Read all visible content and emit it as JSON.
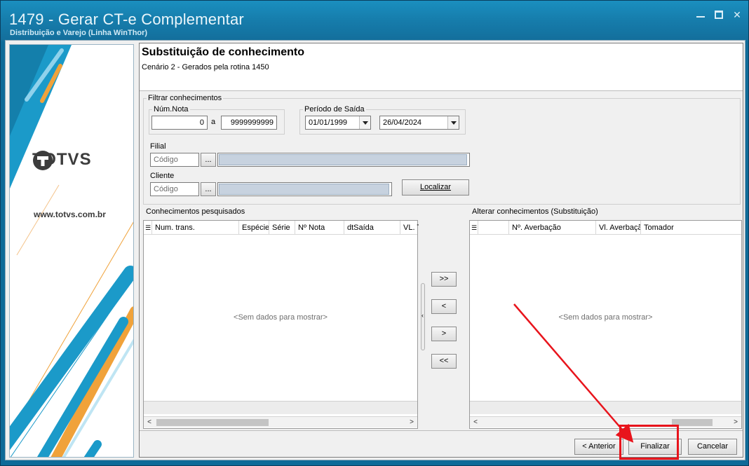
{
  "window": {
    "title": "1479 - Gerar CT-e Complementar",
    "subtitle": "Distribuição e Varejo (Linha WinThor)"
  },
  "brand": {
    "logo_text": "TOTVS",
    "site": "www.totvs.com.br"
  },
  "header": {
    "title": "Substituição de conhecimento",
    "subtitle": "Cenário 2 - Gerados pela rotina 1450"
  },
  "filter": {
    "group_label": "Filtrar conhecimentos",
    "num_nota_label": "Núm.Nota",
    "num_nota_from": "0",
    "range_sep": "a",
    "num_nota_to": "9999999999",
    "periodo_label": "Período de Saída",
    "date_from": "01/01/1999",
    "date_to": "26/04/2024",
    "filial_label": "Filial",
    "filial_placeholder": "Código",
    "cliente_label": "Cliente",
    "cliente_placeholder": "Código",
    "lookup_label": "...",
    "localizar_label": "Localizar"
  },
  "left_grid": {
    "label": "Conhecimentos pesquisados",
    "columns": [
      "Num. trans.",
      "Espécie",
      "Série",
      "Nº Nota",
      "dtSaída",
      "VL. T"
    ],
    "empty": "<Sem dados para mostrar>"
  },
  "right_grid": {
    "label": "Alterar conhecimentos (Substituição)",
    "columns": [
      "Nº. Averbação",
      "Vl. Averbaçã",
      "Tomador"
    ],
    "empty": "<Sem dados para mostrar>"
  },
  "move_buttons": {
    "add_all": ">>",
    "remove_one": "<",
    "add_one": ">",
    "remove_all": "<<"
  },
  "footer": {
    "anterior": "< Anterior",
    "finalizar": "Finalizar",
    "cancelar": "Cancelar"
  },
  "colors": {
    "title_bar": "#167cab",
    "annotation": "#e8141c"
  }
}
